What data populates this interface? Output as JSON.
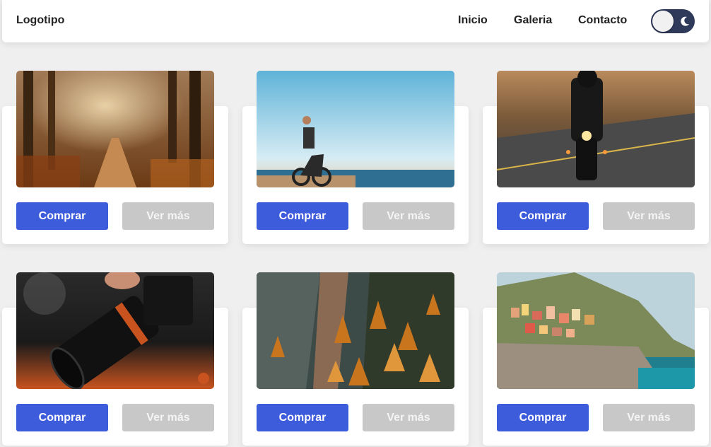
{
  "navbar": {
    "logo": "Logotipo",
    "links": [
      "Inicio",
      "Galeria",
      "Contacto"
    ]
  },
  "colors": {
    "primary_button": "#3d5cdb",
    "secondary_button": "#c8c8c8",
    "toggle_track": "#2f3a5a"
  },
  "icons": [
    "moon-icon"
  ],
  "cards": [
    {
      "image": "forest-path-image",
      "buy_label": "Comprar",
      "more_label": "Ver más"
    },
    {
      "image": "ebike-beach-image",
      "buy_label": "Comprar",
      "more_label": "Ver más"
    },
    {
      "image": "motorcycle-road-image",
      "buy_label": "Comprar",
      "more_label": "Ver más"
    },
    {
      "image": "camera-lens-image",
      "buy_label": "Comprar",
      "more_label": "Ver más"
    },
    {
      "image": "autumn-cliff-image",
      "buy_label": "Comprar",
      "more_label": "Ver más"
    },
    {
      "image": "coastal-village-image",
      "buy_label": "Comprar",
      "more_label": "Ver más"
    }
  ]
}
